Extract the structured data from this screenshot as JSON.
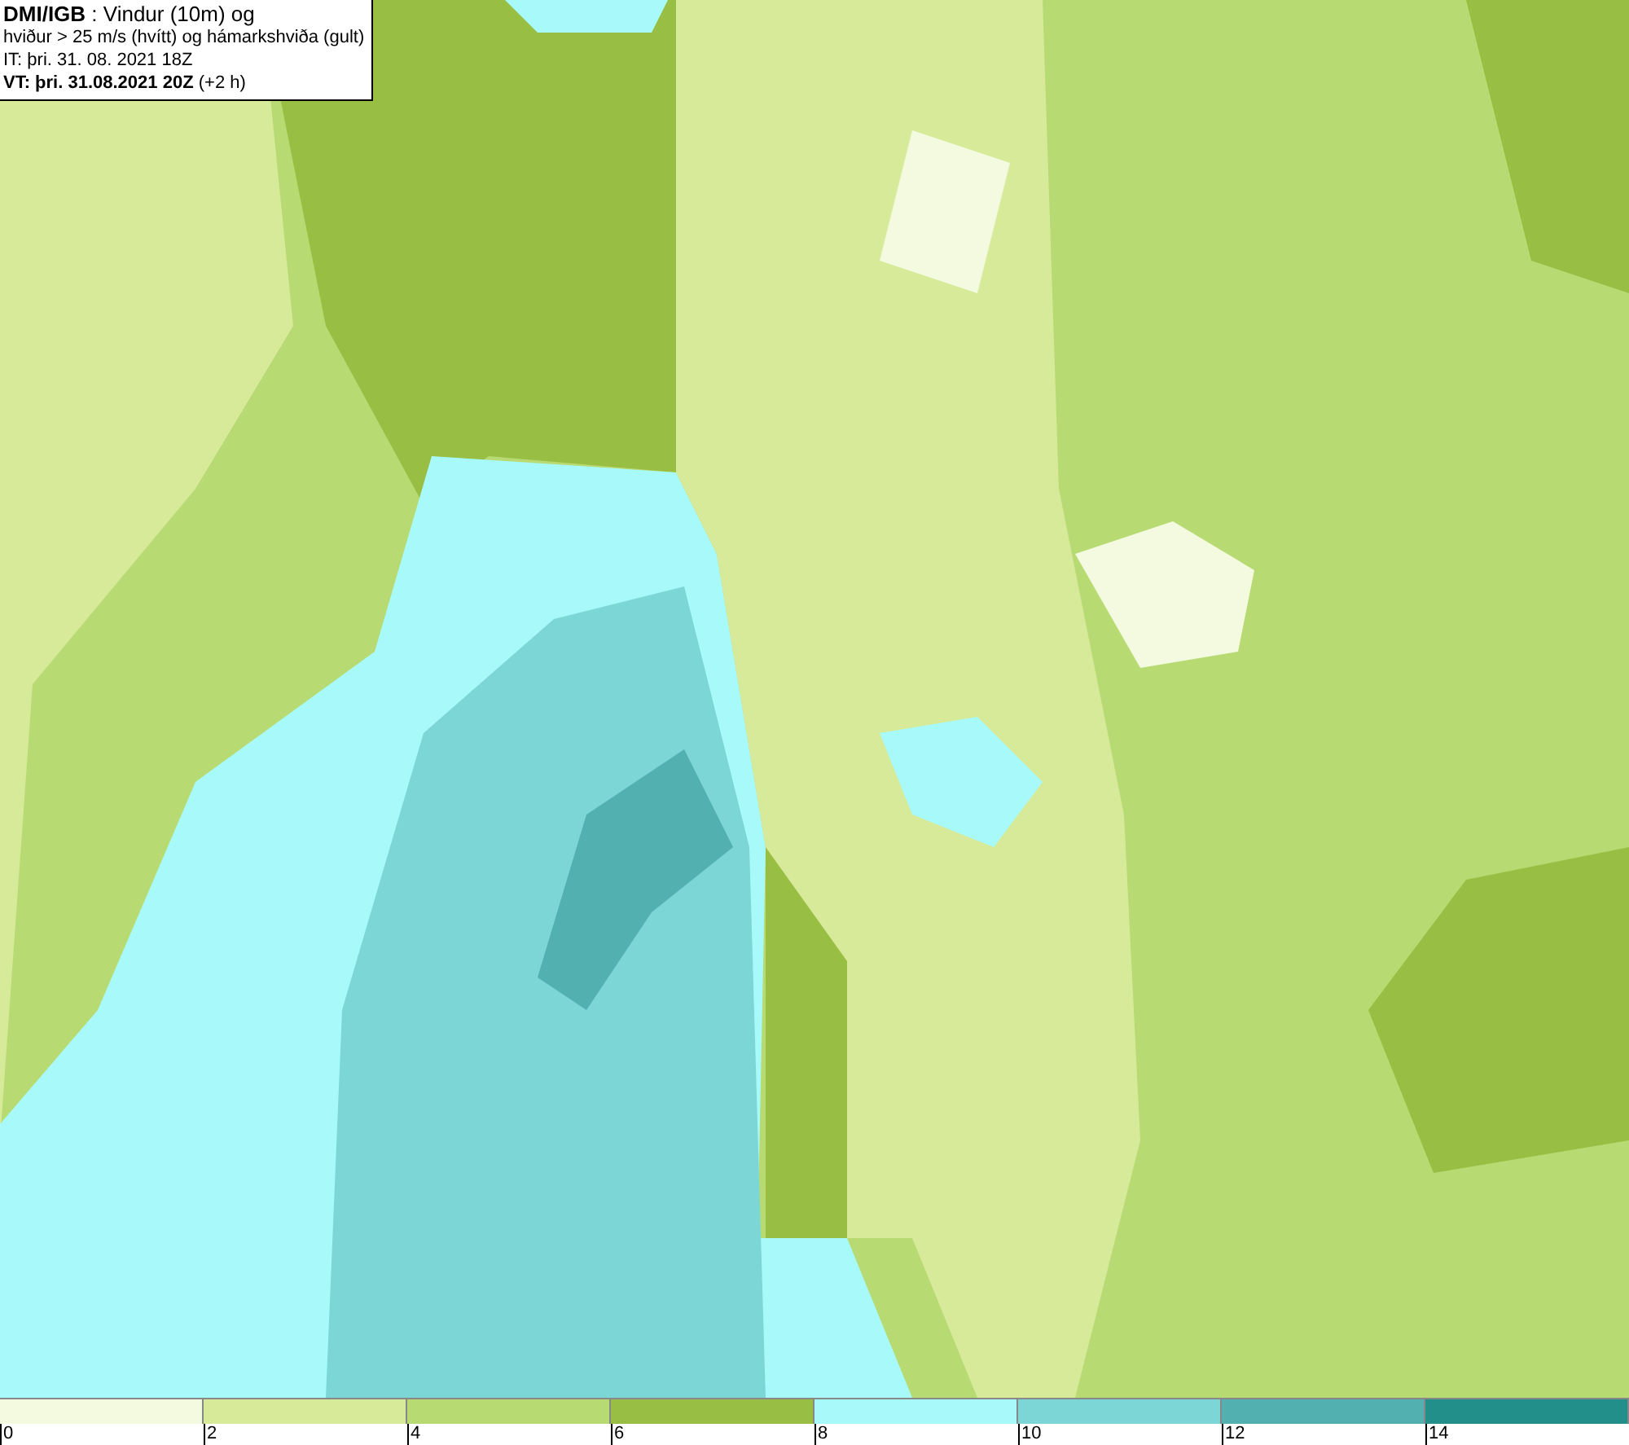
{
  "header": {
    "lines": [
      "**DMI/IGB** : Vindur (10m) og",
      "hviður > 25 m/s (hvítt) og hámarkshviða (gult)",
      "IT: þri. 31. 08. 2021 18Z",
      "**VT: þri. 31.08.2021 20Z** (+2 h)"
    ]
  },
  "legend": [
    {
      "label": "0",
      "color": "#f4fadf"
    },
    {
      "label": "2",
      "color": "#d6ea9a"
    },
    {
      "label": "4",
      "color": "#b8da73"
    },
    {
      "label": "6",
      "color": "#98bf44"
    },
    {
      "label": "8",
      "color": "#a8fafa"
    },
    {
      "label": "10",
      "color": "#7dd6d6"
    },
    {
      "label": "12",
      "color": "#52b0b0"
    },
    {
      "label": "14",
      "color": "#238f8a"
    }
  ]
}
